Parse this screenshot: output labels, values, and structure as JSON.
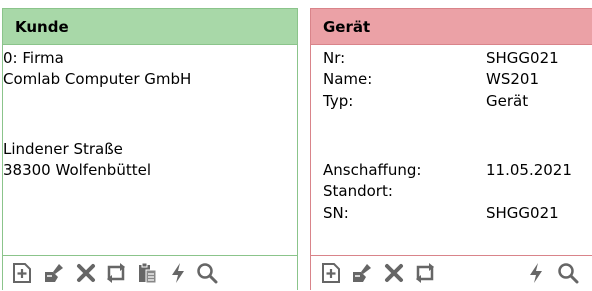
{
  "kunde": {
    "title": "Kunde",
    "lines": [
      "0: Firma",
      "Comlab Computer GmbH",
      "",
      "Lindener Straße",
      "38300 Wolfenbüttel"
    ]
  },
  "geraet": {
    "title": "Gerät",
    "rows": [
      {
        "label": "Nr:",
        "value": "SHGG021"
      },
      {
        "label": "Name:",
        "value": "WS201"
      },
      {
        "label": "Typ:",
        "value": "Gerät"
      },
      {
        "label": "Anschaffung:",
        "value": "11.05.2021"
      },
      {
        "label": "Standort:",
        "value": ""
      },
      {
        "label": "SN:",
        "value": "SHGG021"
      }
    ]
  },
  "toolbar_icons": {
    "kunde": [
      "new-document-icon",
      "edit-icon",
      "delete-icon",
      "exchange-icon",
      "clipboard-icon",
      "lightning-icon",
      "search-icon"
    ],
    "geraet": [
      "new-document-icon",
      "edit-icon",
      "delete-icon",
      "exchange-icon",
      "lightning-icon",
      "search-icon"
    ]
  },
  "colors": {
    "kunde_header": "#a8d8a8",
    "kunde_border": "#8bc48b",
    "geraet_header": "#eba1a6",
    "geraet_border": "#d9848a",
    "icon": "#666666"
  }
}
